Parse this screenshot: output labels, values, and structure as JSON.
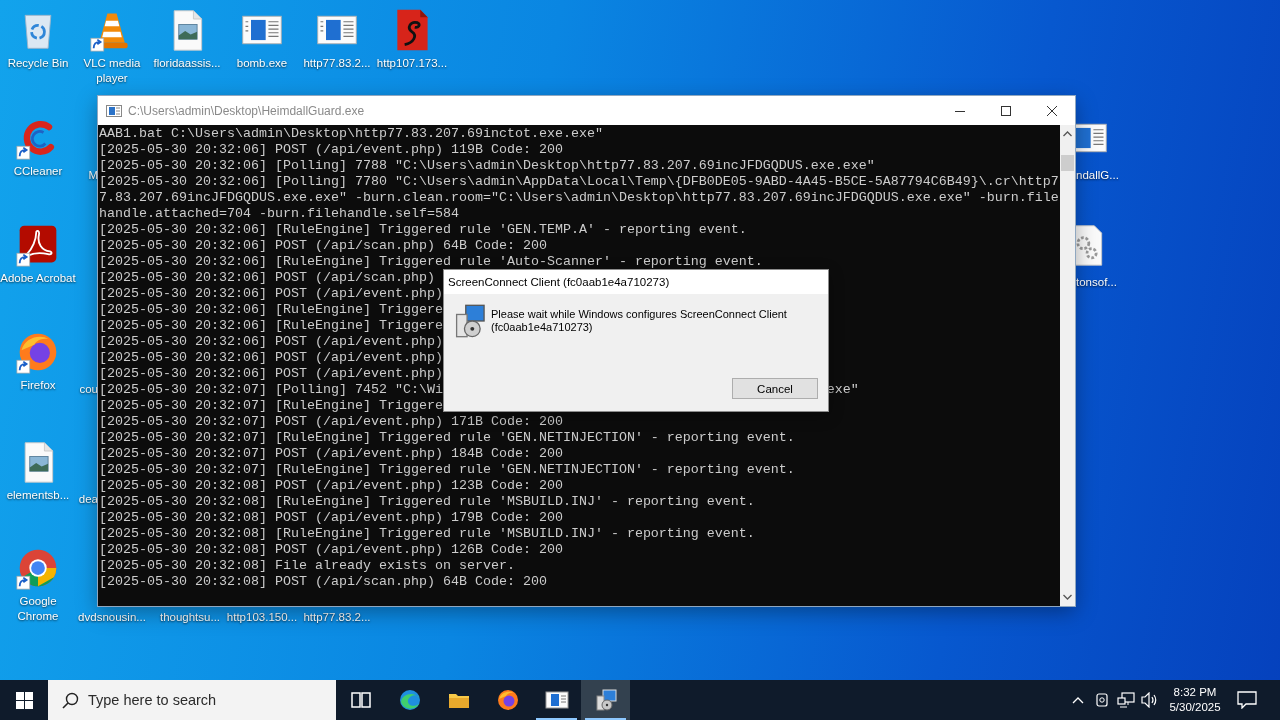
{
  "desktop_icons": [
    {
      "label": "Recycle Bin",
      "kind": "recycle",
      "shortcut": false
    },
    {
      "label": "VLC media player",
      "kind": "vlc",
      "shortcut": true
    },
    {
      "label": "floridaassis...",
      "kind": "image",
      "shortcut": false
    },
    {
      "label": "bomb.exe",
      "kind": "app",
      "shortcut": false
    },
    {
      "label": "http77.83.2...",
      "kind": "app",
      "shortcut": false
    },
    {
      "label": "http107.173...",
      "kind": "pdf",
      "shortcut": false
    },
    {
      "label": "CCleaner",
      "kind": "ccleaner",
      "shortcut": true
    },
    {
      "label": "Adobe Acrobat",
      "kind": "acrobat",
      "shortcut": true
    },
    {
      "label": "Firefox",
      "kind": "firefox",
      "shortcut": true
    },
    {
      "label": "elementsb...",
      "kind": "image",
      "shortcut": false
    },
    {
      "label": "Google Chrome",
      "kind": "chrome",
      "shortcut": true
    },
    {
      "label": "M"
    },
    {
      "label": "cou"
    },
    {
      "label": "dea"
    },
    {
      "label": "dvdsnousin..."
    },
    {
      "label": "thoughtsu..."
    },
    {
      "label": "http103.150..."
    },
    {
      "label": "http77.83.2..."
    },
    {
      "label": "ndallG...",
      "kind": "app",
      "shortcut": false
    },
    {
      "label": "tonsof...",
      "kind": "gear",
      "shortcut": false
    }
  ],
  "console_window": {
    "title": "C:\\Users\\admin\\Desktop\\HeimdallGuard.exe",
    "lines": [
      {
        "text": "AAB1.bat C:\\Users\\admin\\Desktop\\http77.83.207.69inctot.exe.exe\""
      },
      {
        "text": "[2025-05-30 20:32:06] POST (/api/event.php) 119B Code: 200"
      },
      {
        "text": "[2025-05-30 20:32:06] [Polling] 7788 \"C:\\Users\\admin\\Desktop\\http77.83.207.69incJFDGQDUS.exe.exe\""
      },
      {
        "text": "[2025-05-30 20:32:06] [Polling] 7780 \"C:\\Users\\admin\\AppData\\Local\\Temp\\{DFB0DE05-9ABD-4A45-B5CE-5A87794C6B49}\\.cr\\http7"
      },
      {
        "text": "7.83.207.69incJFDGQDUS.exe.exe\" -burn.clean.room=\"C:\\Users\\admin\\Desktop\\http77.83.207.69incJFDGQDUS.exe.exe\" -burn.file"
      },
      {
        "text": "handle.attached=704 -burn.filehandle.self=584"
      },
      {
        "text": "[2025-05-30 20:32:06] [RuleEngine] Triggered rule 'GEN.TEMP.A' - reporting event."
      },
      {
        "text": "[2025-05-30 20:32:06] POST (/api/scan.php) 64B Code: 200"
      },
      {
        "text": "[2025-05-30 20:32:06] [RuleEngine] Triggered rule 'Auto-Scanner' - reporting event."
      },
      {
        "text": "[2025-05-30 20:32:06] POST (/api/scan.php)"
      },
      {
        "text": "[2025-05-30 20:32:06] POST (/api/event.php)"
      },
      {
        "text": "[2025-05-30 20:32:06] [RuleEngine] Triggere"
      },
      {
        "text": "[2025-05-30 20:32:06] [RuleEngine] Triggere"
      },
      {
        "text": "[2025-05-30 20:32:06] POST (/api/event.php)"
      },
      {
        "text": "[2025-05-30 20:32:06] POST (/api/event.php)"
      },
      {
        "text": "[2025-05-30 20:32:06] POST (/api/event.php)"
      },
      {
        "text": "[2025-05-30 20:32:07] [Polling] 7452 \"C:\\Wi",
        "tail": "exe\""
      },
      {
        "text": "[2025-05-30 20:32:07] [RuleEngine] Triggere"
      },
      {
        "text": "[2025-05-30 20:32:07] POST (/api/event.php) 171B Code: 200"
      },
      {
        "text": "[2025-05-30 20:32:07] [RuleEngine] Triggered rule 'GEN.NETINJECTION' - reporting event."
      },
      {
        "text": "[2025-05-30 20:32:07] POST (/api/event.php) 184B Code: 200"
      },
      {
        "text": "[2025-05-30 20:32:07] [RuleEngine] Triggered rule 'GEN.NETINJECTION' - reporting event."
      },
      {
        "text": "[2025-05-30 20:32:08] POST (/api/event.php) 123B Code: 200"
      },
      {
        "text": "[2025-05-30 20:32:08] [RuleEngine] Triggered rule 'MSBUILD.INJ' - reporting event."
      },
      {
        "text": "[2025-05-30 20:32:08] POST (/api/event.php) 179B Code: 200"
      },
      {
        "text": "[2025-05-30 20:32:08] [RuleEngine] Triggered rule 'MSBUILD.INJ' - reporting event."
      },
      {
        "text": "[2025-05-30 20:32:08] POST (/api/event.php) 126B Code: 200"
      },
      {
        "text": "[2025-05-30 20:32:08] File already exists on server."
      },
      {
        "text": "[2025-05-30 20:32:08] POST (/api/scan.php) 64B Code: 200"
      }
    ]
  },
  "dialog": {
    "title": "ScreenConnect Client (fc0aab1e4a710273)",
    "message": "Please wait while Windows configures ScreenConnect Client (fc0aab1e4a710273)",
    "button": "Cancel"
  },
  "taskbar": {
    "search_placeholder": "Type here to search",
    "apps": [
      {
        "kind": "task-view",
        "running": false,
        "selected": false
      },
      {
        "kind": "edge",
        "running": false,
        "selected": false
      },
      {
        "kind": "explorer",
        "running": false,
        "selected": false
      },
      {
        "kind": "firefox",
        "running": false,
        "selected": false
      },
      {
        "kind": "console",
        "running": true,
        "selected": false
      },
      {
        "kind": "installer",
        "running": true,
        "selected": true
      }
    ],
    "clock": {
      "time": "8:32 PM",
      "date": "5/30/2025"
    }
  }
}
